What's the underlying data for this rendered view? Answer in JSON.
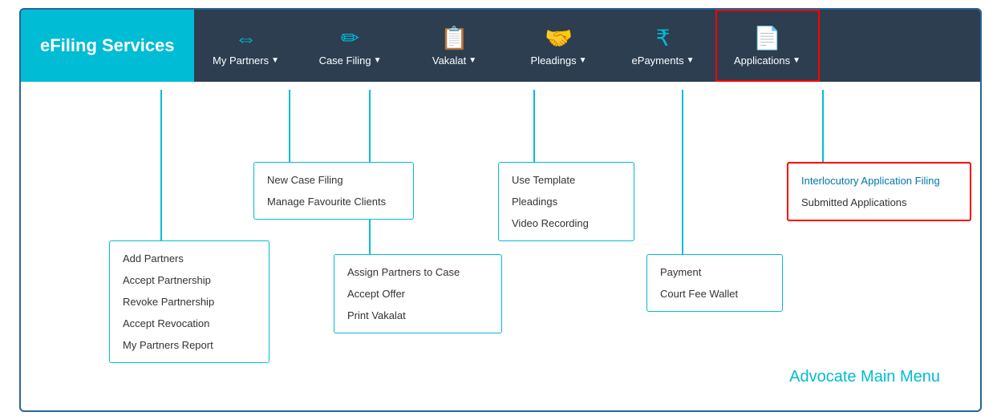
{
  "brand": {
    "label": "eFiling Services"
  },
  "nav": {
    "items": [
      {
        "id": "my-partners",
        "icon": "↔",
        "label": "My Partners",
        "highlighted": false
      },
      {
        "id": "case-filing",
        "icon": "✏",
        "label": "Case Filing",
        "highlighted": false
      },
      {
        "id": "vakalat",
        "icon": "📋",
        "label": "Vakalat",
        "highlighted": false
      },
      {
        "id": "pleadings",
        "icon": "🤝",
        "label": "Pleadings",
        "highlighted": false
      },
      {
        "id": "epayments",
        "icon": "₹",
        "label": "ePayments",
        "highlighted": false
      },
      {
        "id": "applications",
        "icon": "📄",
        "label": "Applications",
        "highlighted": true
      }
    ]
  },
  "dropdowns": {
    "case_filing": {
      "items": [
        "New Case Filing",
        "Manage Favourite Clients"
      ]
    },
    "my_partners": {
      "items": [
        "Add Partners",
        "Accept Partnership",
        "Revoke Partnership",
        "Accept Revocation",
        "My Partners Report"
      ]
    },
    "vakalat": {
      "items": [
        "Assign Partners to Case",
        "Accept Offer",
        "Print Vakalat"
      ]
    },
    "pleadings": {
      "items": [
        "Use Template",
        "Pleadings",
        "Video Recording"
      ]
    },
    "epayments": {
      "items": [
        "Payment",
        "Court Fee Wallet"
      ]
    },
    "applications": {
      "items": [
        "Interlocutory Application Filing",
        "Submitted Applications"
      ],
      "highlighted_item": "Interlocutory Application Filing"
    }
  },
  "footer": {
    "label": "Advocate Main Menu"
  }
}
